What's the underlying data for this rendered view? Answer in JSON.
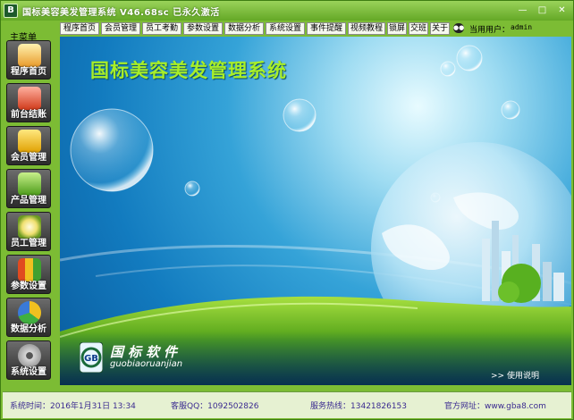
{
  "window": {
    "title": "国标美容美发管理系统 V46.68sc 已永久激活",
    "icon_letter": "B",
    "controls": [
      "—",
      "□",
      "✕"
    ]
  },
  "sidebar": {
    "heading": "主菜单",
    "items": [
      {
        "label": "程序首页",
        "icon": "house-icon"
      },
      {
        "label": "前台结账",
        "icon": "cash-register-icon"
      },
      {
        "label": "会员管理",
        "icon": "vip-card-icon"
      },
      {
        "label": "产品管理",
        "icon": "product-boxes-icon"
      },
      {
        "label": "员工管理",
        "icon": "clock-icon"
      },
      {
        "label": "参数设置",
        "icon": "bar-chart-icon"
      },
      {
        "label": "数据分析",
        "icon": "pie-chart-icon"
      },
      {
        "label": "系统设置",
        "icon": "gear-icon"
      }
    ]
  },
  "menubar": {
    "items": [
      "程序首页",
      "会员管理",
      "员工考勤",
      "参数设置",
      "数据分析",
      "系统设置",
      "事件提醒",
      "视频教程",
      "锁屏",
      "交班",
      "关于"
    ],
    "user_label": "当用用户：",
    "user_name": "admin"
  },
  "main": {
    "banner": "国标美容美发管理系统",
    "company_name": "国标软件",
    "company_pinyin": "guobiaoruanjian",
    "logo_letters": "GB",
    "help_link": ">> 使用说明"
  },
  "status": {
    "time_label": "系统时间：",
    "time_value": "2016年1月31日  13:34",
    "qq_label": "客服QQ：",
    "qq_value": "1092502826",
    "hotline_label": "服务热线：",
    "hotline_value": "13421826153",
    "site_label": "官方网址：",
    "site_value": "www.gba8.com"
  },
  "colors": {
    "frame": "#7cbc34",
    "banner_text": "#a8ee28",
    "sky": "#127bbf",
    "grass": "#5fb31c"
  }
}
